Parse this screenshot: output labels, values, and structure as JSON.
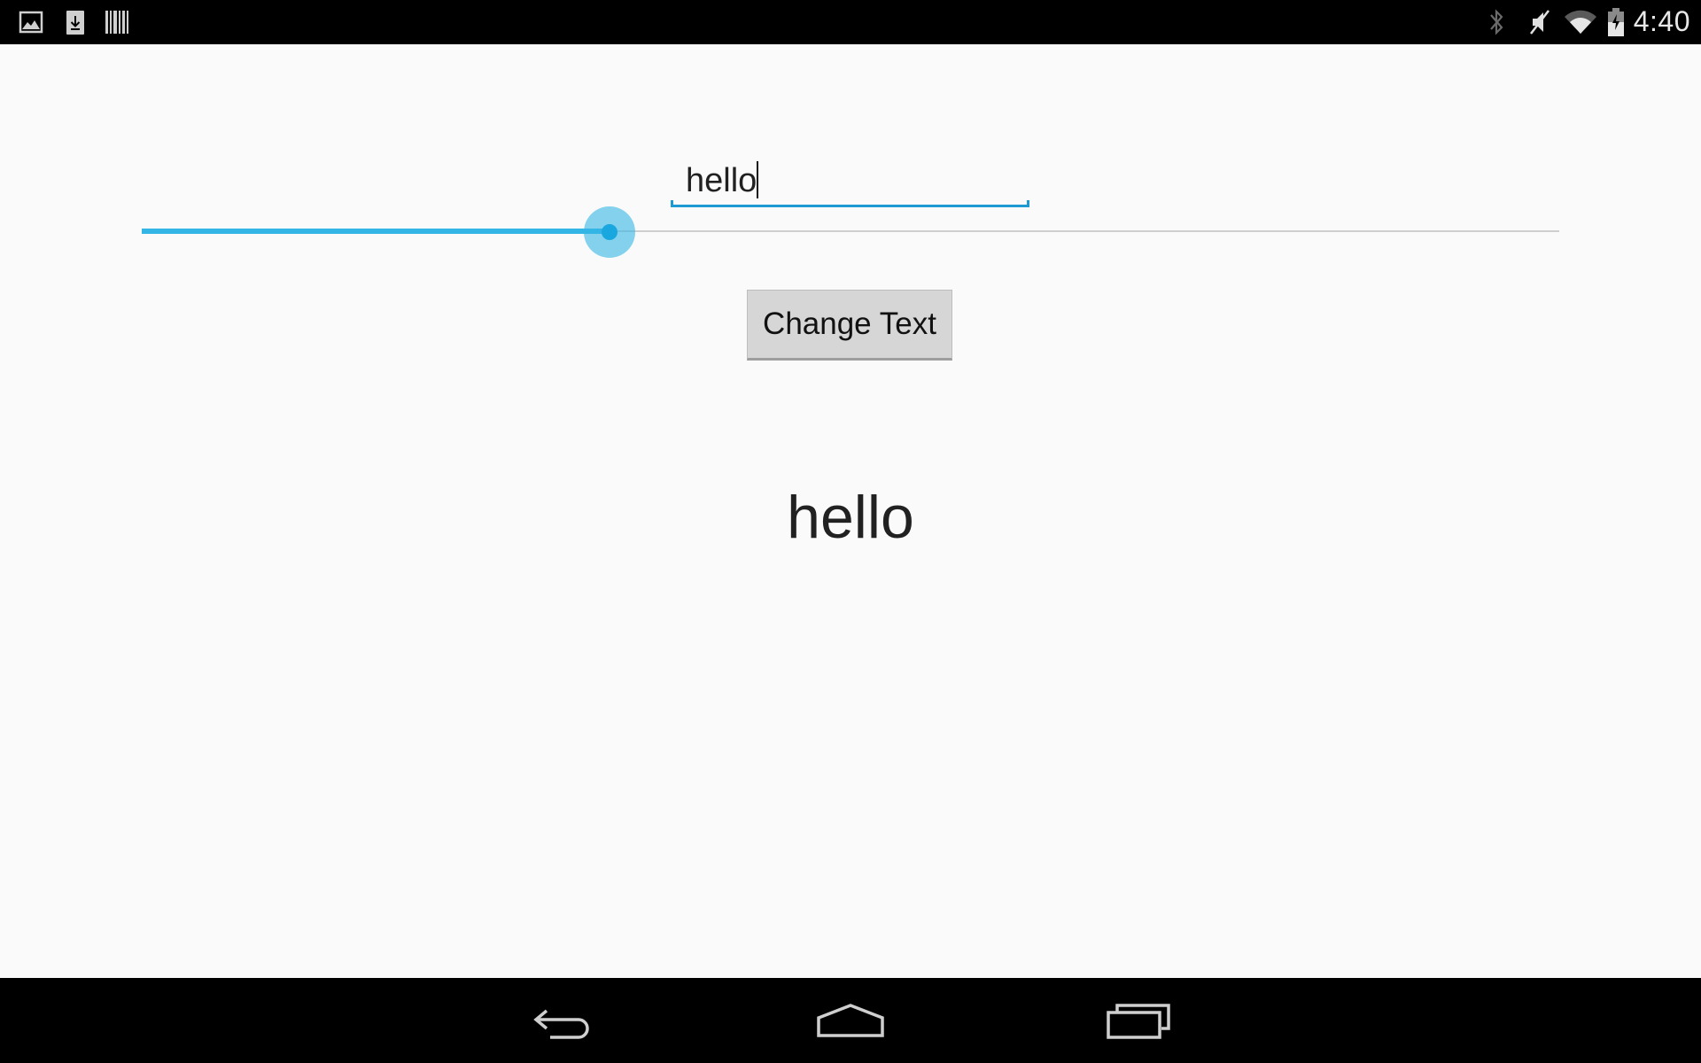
{
  "status_bar": {
    "time": "4:40",
    "notification_icons": [
      "gallery-icon",
      "download-icon",
      "barcode-icon"
    ],
    "system_icons": [
      "bluetooth-icon",
      "mute-icon",
      "wifi-icon",
      "battery-icon"
    ]
  },
  "edit_text": {
    "value": "hello"
  },
  "seekbar": {
    "progress_fraction": 0.33
  },
  "button": {
    "label": "Change Text"
  },
  "display": {
    "text": "hello"
  },
  "nav_bar": {
    "buttons": [
      "back-icon",
      "home-icon",
      "recent-apps-icon"
    ]
  },
  "colors": {
    "accent": "#33b5e5",
    "background": "#fafafa",
    "bars": "#000000"
  }
}
